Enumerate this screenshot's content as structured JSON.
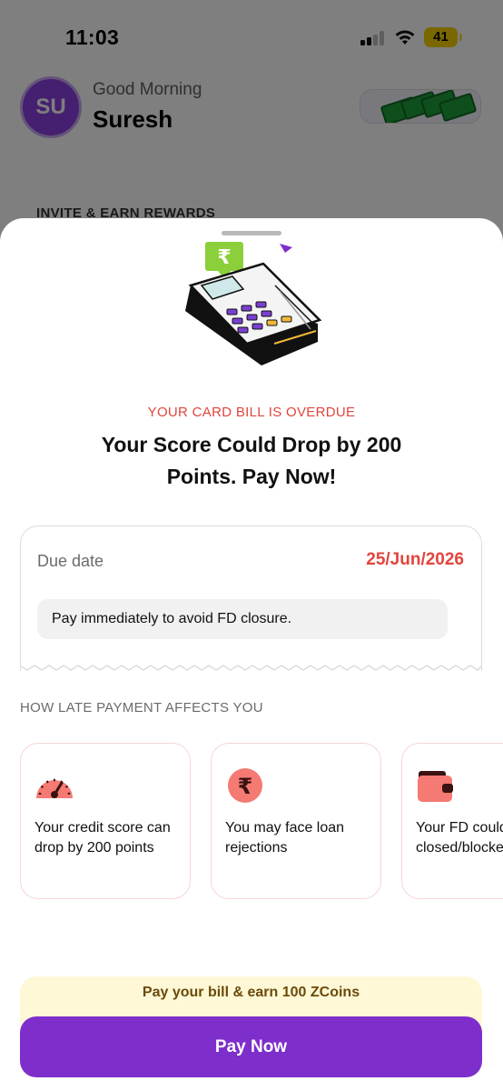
{
  "status_bar": {
    "time": "11:03",
    "battery": "41"
  },
  "header": {
    "avatar_initials": "SU",
    "greeting": "Good Morning",
    "user_name": "Suresh",
    "rewards_icon": "cash-stack-icon"
  },
  "background": {
    "section_peek": "INVITE & EARN REWARDS"
  },
  "sheet": {
    "overdue_label": "YOUR CARD BILL IS OVERDUE",
    "headline": "Your Score Could Drop by 200 Points. Pay Now!",
    "due": {
      "label": "Due date",
      "value": "25/Jun/2026",
      "note": "Pay immediately to avoid FD closure."
    },
    "section_title": "HOW LATE PAYMENT AFFECTS YOU",
    "impacts": [
      {
        "icon": "speedometer-icon",
        "text": "Your credit score can drop by 200 points"
      },
      {
        "icon": "rupee-icon",
        "text": "You may face loan rejections"
      },
      {
        "icon": "wallet-icon",
        "text": "Your FD could be closed/blocked"
      }
    ],
    "zcoins_banner": "Pay your bill & earn 100 ZCoins",
    "pay_button": "Pay Now"
  },
  "colors": {
    "accent_purple": "#7e2ecb",
    "alert_red": "#e2453d",
    "banner_yellow": "#fef8d6",
    "card_pink_border": "#f6d6d6"
  }
}
